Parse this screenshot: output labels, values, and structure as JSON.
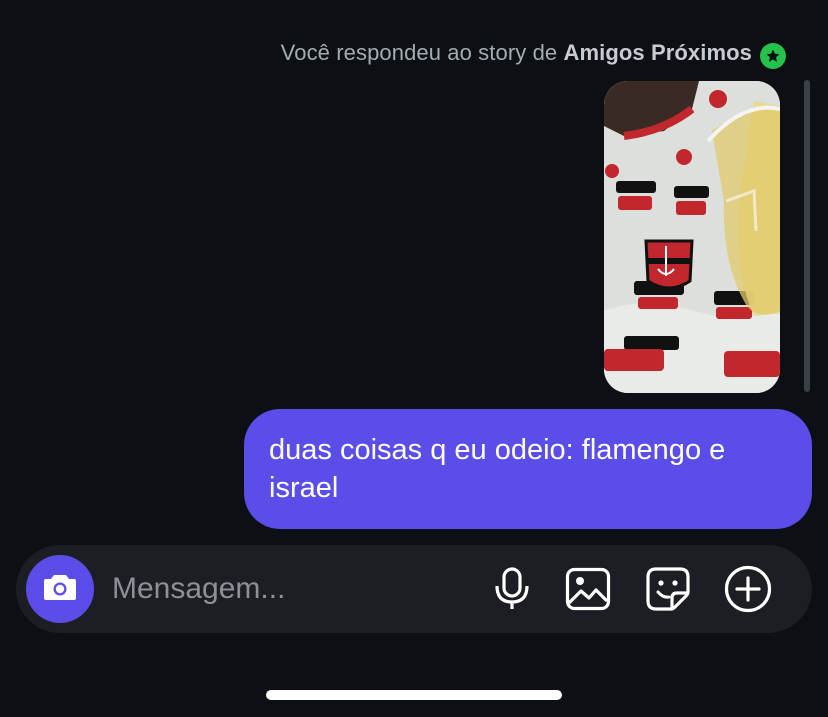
{
  "story_reply": {
    "prefix": "Você respondeu ao story de ",
    "audience": "Amigos Próximos",
    "badge_icon": "star-icon",
    "badge_color": "#25c14a"
  },
  "message": {
    "text": "duas coisas q eu odeio: flamengo e israel",
    "bubble_color": "#5a4de8"
  },
  "composer": {
    "placeholder": "Mensagem...",
    "camera_icon": "camera-icon",
    "icons": [
      "microphone-icon",
      "gallery-icon",
      "sticker-icon",
      "plus-icon"
    ]
  },
  "theme": {
    "background": "#0c0f14",
    "accent": "#5a4de8"
  }
}
